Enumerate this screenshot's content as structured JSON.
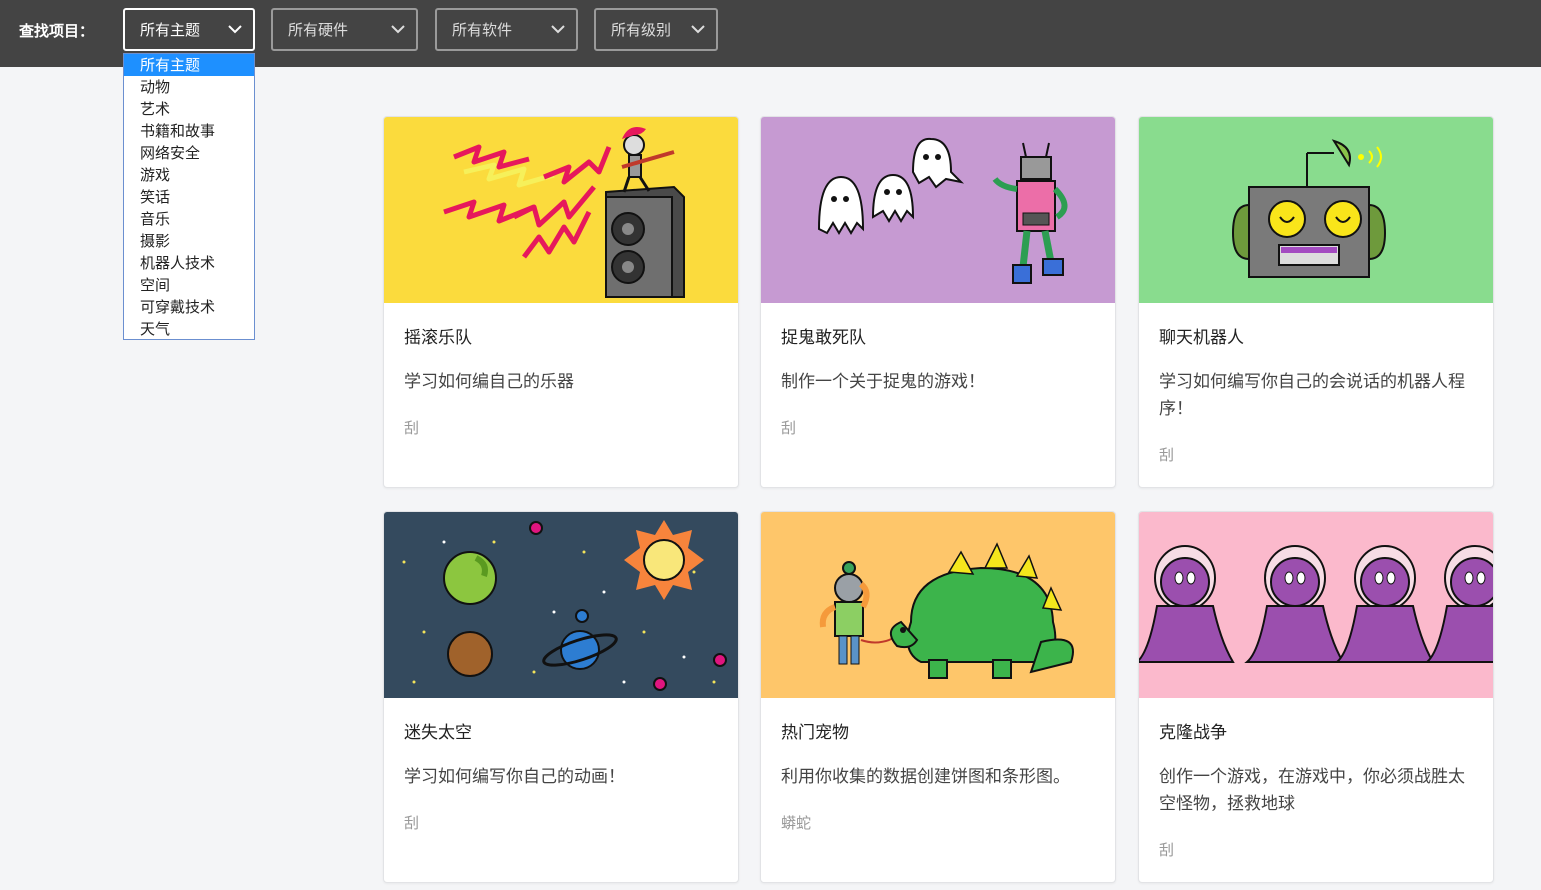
{
  "toolbar": {
    "find_label": "查找项目：",
    "filters": [
      {
        "selected": "所有主题"
      },
      {
        "selected": "所有硬件"
      },
      {
        "selected": "所有软件"
      },
      {
        "selected": "所有级别"
      }
    ]
  },
  "topic_dropdown": {
    "options": [
      "所有主题",
      "动物",
      "艺术",
      "书籍和故事",
      "网络安全",
      "游戏",
      "笑话",
      "音乐",
      "摄影",
      "机器人技术",
      "空间",
      "可穿戴技术",
      "天气"
    ]
  },
  "projects": [
    {
      "title": "摇滚乐队",
      "description": "学习如何编自己的乐器",
      "tag": "刮",
      "image_icon": "rock-band-illustration",
      "bg": "#fbdb3d"
    },
    {
      "title": "捉鬼敢死队",
      "description": "制作一个关于捉鬼的游戏！",
      "tag": "刮",
      "image_icon": "ghostbusters-illustration",
      "bg": "#c69ad2"
    },
    {
      "title": "聊天机器人",
      "description": "学习如何编写你自己的会说话的机器人程序！",
      "tag": "刮",
      "image_icon": "chatbot-robot-illustration",
      "bg": "#89dc8e"
    },
    {
      "title": "迷失太空",
      "description": "学习如何编写你自己的动画！",
      "tag": "刮",
      "image_icon": "space-planets-illustration",
      "bg": "#344a5e"
    },
    {
      "title": "热门宠物",
      "description": "利用你收集的数据创建饼图和条形图。",
      "tag": "蟒蛇",
      "image_icon": "pet-dinosaur-illustration",
      "bg": "#fec66a"
    },
    {
      "title": "克隆战争",
      "description": "创作一个游戏，在游戏中，你必须战胜太空怪物，拯救地球",
      "tag": "刮",
      "image_icon": "space-monsters-illustration",
      "bg": "#fbb9cc"
    }
  ]
}
